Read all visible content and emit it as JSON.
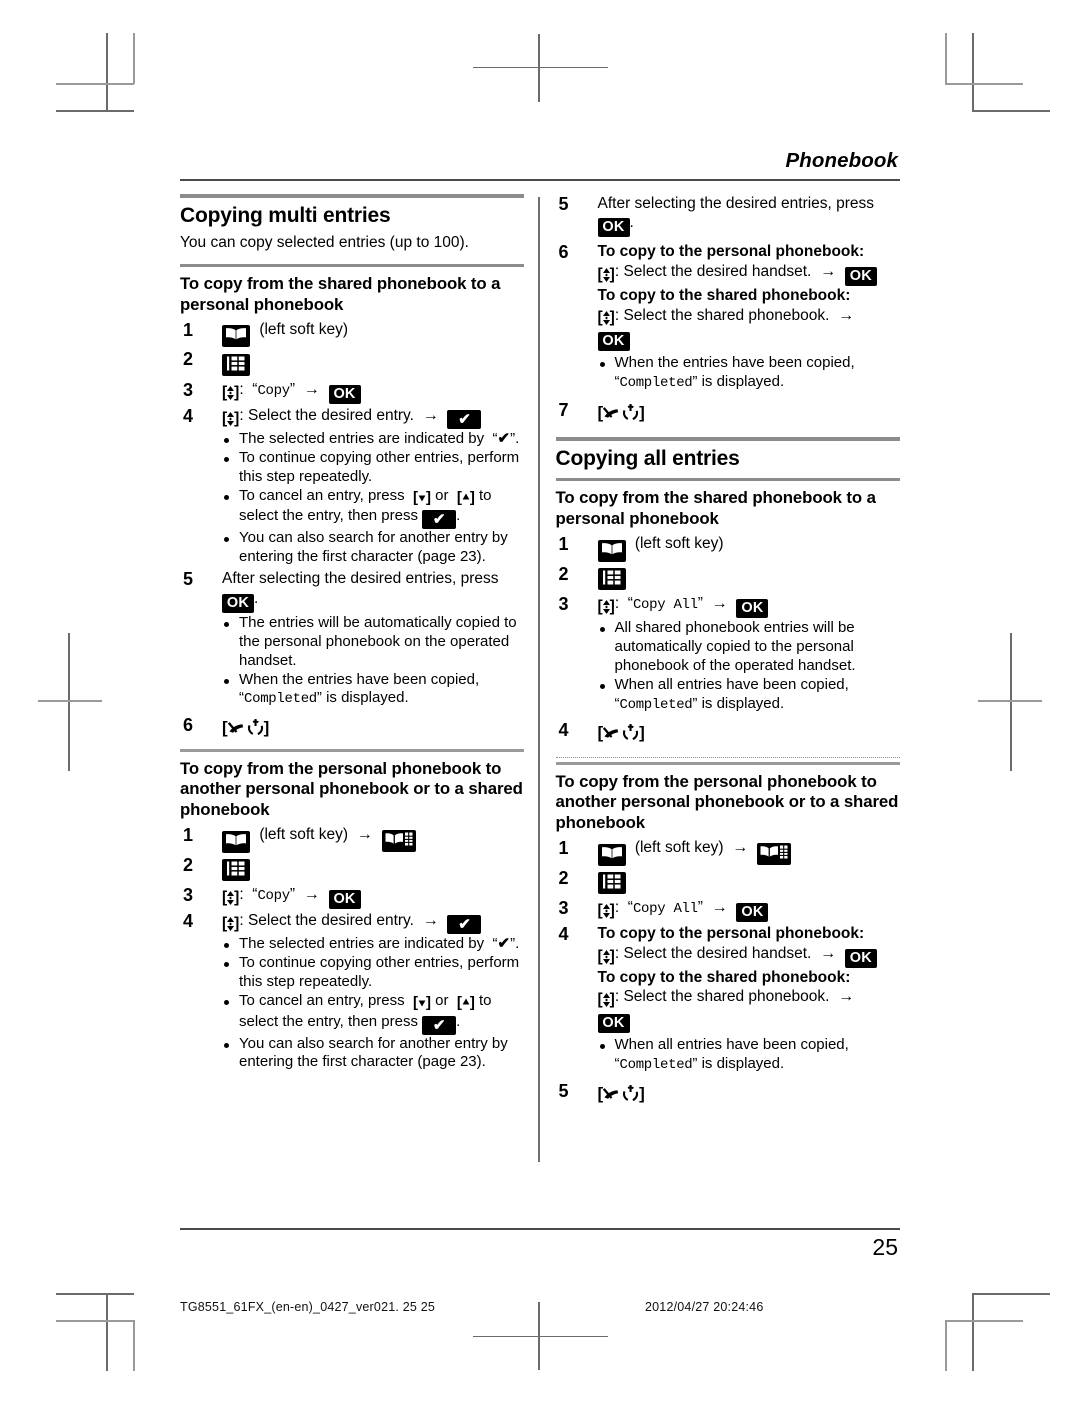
{
  "header": {
    "running_head": "Phonebook"
  },
  "page_number": "25",
  "print_footer": {
    "left": "TG8551_61FX_(en-en)_0427_ver021. 25    25",
    "right": "2012/04/27    20:24:46"
  },
  "icons": {
    "phonebook_key": "phonebook-book-icon",
    "menu_key": "menu-grid-icon",
    "personal_phonebook_key": "personal-phonebook-icon",
    "nav_updown_key": "nav-up-down-icon",
    "ok_key": "OK",
    "check_key": "checkmark-icon",
    "off_key": "off-power-icon",
    "down_key": "down-arrow-icon",
    "up_key": "up-arrow-icon",
    "arrow": "→"
  },
  "left_column": {
    "section": {
      "title": "Copying multi entries",
      "intro": "You can copy selected entries (up to 100)."
    },
    "sub1": {
      "title": "To copy from the shared phonebook to a personal phonebook",
      "steps": [
        {
          "num": "1",
          "text_after_icon": "(left soft key)"
        },
        {
          "num": "2",
          "text_after_icon": ""
        },
        {
          "num": "3",
          "label": ":",
          "quoted": "Copy",
          "tail": ""
        },
        {
          "num": "4",
          "label": ": Select the desired entry.",
          "bullets": [
            "The selected entries are indicated by “✔”.",
            "To continue copying other entries, perform this step repeatedly.",
            "To cancel an entry, press [▼] or [▲] to select the entry, then press ✔.",
            "You can also search for another entry by entering the first character (page 23)."
          ]
        },
        {
          "num": "5",
          "text": "After selecting the desired entries, press",
          "bullets": [
            "The entries will be automatically copied to the personal phonebook on the operated handset.",
            "When the entries have been copied, “Completed” is displayed."
          ]
        },
        {
          "num": "6",
          "text": ""
        }
      ]
    },
    "sub2": {
      "title": "To copy from the personal phonebook to another personal phonebook or to a shared phonebook",
      "steps": [
        {
          "num": "1",
          "text_after_icon": "(left soft key)"
        },
        {
          "num": "2",
          "text_after_icon": ""
        },
        {
          "num": "3",
          "label": ":",
          "quoted": "Copy"
        },
        {
          "num": "4",
          "label": ": Select the desired entry.",
          "bullets": [
            "The selected entries are indicated by “✔”.",
            "To continue copying other entries, perform this step repeatedly.",
            "To cancel an entry, press [▼] or [▲] to select the entry, then press ✔.",
            "You can also search for another entry by entering the first character (page 23)."
          ]
        }
      ]
    },
    "bullet_texts": {
      "b1_a": "The selected entries are indicated by",
      "b1_b": "”.",
      "b2": "To continue copying other entries, perform this step repeatedly.",
      "b3_a": "To cancel an entry, press",
      "b3_b": "or",
      "b3_c": "to select the entry, then press",
      "b4": "You can also search for another entry by entering the first character (page 23)."
    },
    "step5": {
      "text": "After selecting the desired entries, press",
      "b1": "The entries will be automatically copied to the personal phonebook on the operated handset.",
      "b2_a": "When the entries have been copied,",
      "b2_mono": "Completed",
      "b2_b": "is displayed."
    },
    "labels": {
      "left_soft_key": "(left soft key)",
      "copy": "Copy",
      "select_entry": ": Select the desired entry.",
      "colon": ":"
    }
  },
  "right_column": {
    "cont_steps": {
      "step5": {
        "num": "5",
        "text": "After selecting the desired entries, press"
      },
      "step6": {
        "num": "6",
        "line1": "To copy to the personal phonebook:",
        "line2": ": Select the desired handset.",
        "line3": "To copy to the shared phonebook:",
        "line4": ": Select the shared phonebook.",
        "bullet_a": "When the entries have been copied,",
        "bullet_mono": "Completed",
        "bullet_b": "is displayed."
      },
      "step7": {
        "num": "7"
      }
    },
    "section": {
      "title": "Copying all entries"
    },
    "sub1": {
      "title": "To copy from the shared phonebook to a personal phonebook",
      "step1": {
        "num": "1",
        "text": "(left soft key)"
      },
      "step2": {
        "num": "2"
      },
      "step3": {
        "num": "3",
        "colon": ":",
        "quoted": "Copy All",
        "bullets": [
          "All shared phonebook entries will be automatically copied to the personal phonebook of the operated handset.",
          "When all entries have been copied, “Completed” is displayed."
        ],
        "b1": "All shared phonebook entries will be automatically copied to the personal phonebook of the operated handset.",
        "b2_a": "When all entries have been copied,",
        "b2_mono": "Completed",
        "b2_b": "is displayed."
      },
      "step4": {
        "num": "4"
      }
    },
    "sub2": {
      "title": "To copy from the personal phonebook to another personal phonebook or to a shared phonebook",
      "step1": {
        "num": "1",
        "text": "(left soft key)"
      },
      "step2": {
        "num": "2"
      },
      "step3": {
        "num": "3",
        "colon": ":",
        "quoted": "Copy All"
      },
      "step4": {
        "num": "4",
        "line1": "To copy to the personal phonebook:",
        "line2": ": Select the desired handset.",
        "line3": "To copy to the shared phonebook:",
        "line4": ": Select the shared phonebook.",
        "bullet_a": "When all entries have been copied,",
        "bullet_mono": "Completed",
        "bullet_b": "is displayed."
      },
      "step5": {
        "num": "5"
      }
    }
  }
}
